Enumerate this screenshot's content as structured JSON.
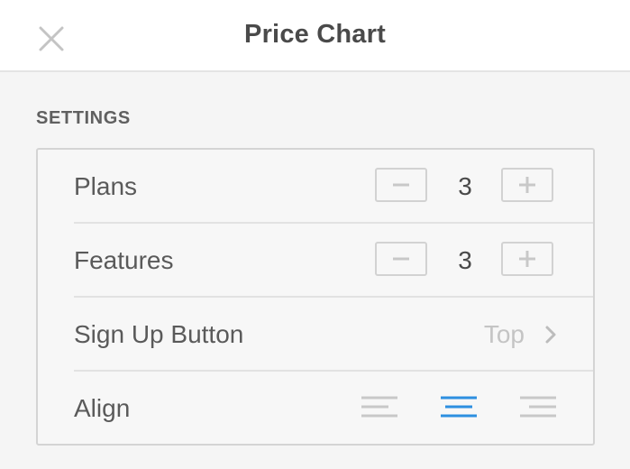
{
  "header": {
    "title": "Price Chart",
    "close_icon": "close-icon"
  },
  "settings": {
    "section_label": "SETTINGS",
    "rows": {
      "plans": {
        "label": "Plans",
        "value": "3"
      },
      "features": {
        "label": "Features",
        "value": "3"
      },
      "signup": {
        "label": "Sign Up Button",
        "value": "Top"
      },
      "align": {
        "label": "Align",
        "options": [
          "align-left-icon",
          "align-center-icon",
          "align-right-icon"
        ],
        "selected": "center"
      }
    }
  },
  "colors": {
    "accent": "#2d8fe0",
    "inactive_icon": "#c8c8c8",
    "border": "#d4d4d4",
    "background": "#f5f5f5"
  }
}
